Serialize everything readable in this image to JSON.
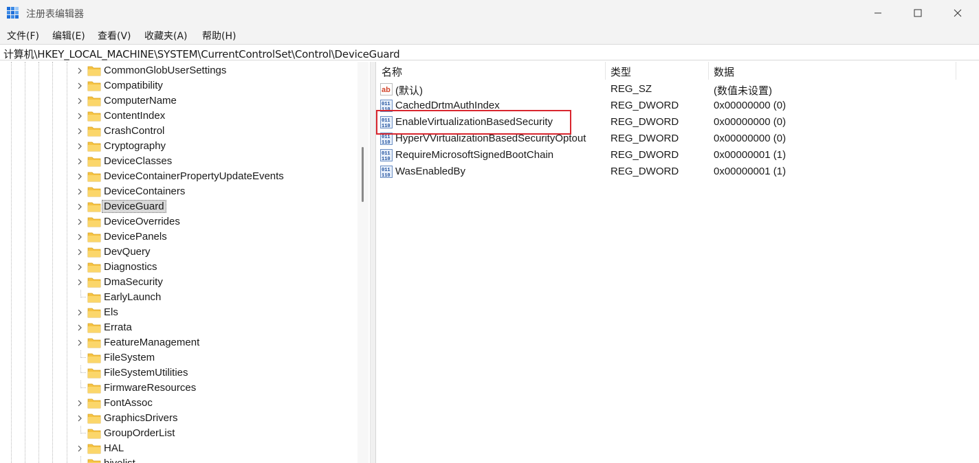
{
  "window": {
    "title": "注册表编辑器"
  },
  "menu": [
    "文件(F)",
    "编辑(E)",
    "查看(V)",
    "收藏夹(A)",
    "帮助(H)"
  ],
  "address": "计算机\\HKEY_LOCAL_MACHINE\\SYSTEM\\CurrentControlSet\\Control\\DeviceGuard",
  "tree": {
    "items": [
      {
        "label": "CommonGlobUserSettings",
        "expandable": true
      },
      {
        "label": "Compatibility",
        "expandable": true
      },
      {
        "label": "ComputerName",
        "expandable": true
      },
      {
        "label": "ContentIndex",
        "expandable": true
      },
      {
        "label": "CrashControl",
        "expandable": true
      },
      {
        "label": "Cryptography",
        "expandable": true
      },
      {
        "label": "DeviceClasses",
        "expandable": true
      },
      {
        "label": "DeviceContainerPropertyUpdateEvents",
        "expandable": true
      },
      {
        "label": "DeviceContainers",
        "expandable": true
      },
      {
        "label": "DeviceGuard",
        "expandable": true,
        "selected": true
      },
      {
        "label": "DeviceOverrides",
        "expandable": true
      },
      {
        "label": "DevicePanels",
        "expandable": true
      },
      {
        "label": "DevQuery",
        "expandable": true
      },
      {
        "label": "Diagnostics",
        "expandable": true
      },
      {
        "label": "DmaSecurity",
        "expandable": true
      },
      {
        "label": "EarlyLaunch",
        "expandable": false
      },
      {
        "label": "Els",
        "expandable": true
      },
      {
        "label": "Errata",
        "expandable": true
      },
      {
        "label": "FeatureManagement",
        "expandable": true
      },
      {
        "label": "FileSystem",
        "expandable": false
      },
      {
        "label": "FileSystemUtilities",
        "expandable": false
      },
      {
        "label": "FirmwareResources",
        "expandable": false
      },
      {
        "label": "FontAssoc",
        "expandable": true
      },
      {
        "label": "GraphicsDrivers",
        "expandable": true
      },
      {
        "label": "GroupOrderList",
        "expandable": false
      },
      {
        "label": "HAL",
        "expandable": true
      },
      {
        "label": "hivelist",
        "expandable": false
      }
    ]
  },
  "list": {
    "columns": {
      "name": "名称",
      "type": "类型",
      "data": "数据"
    },
    "rows": [
      {
        "name": "(默认)",
        "type": "REG_SZ",
        "data": "(数值未设置)",
        "icon": "string-value-icon"
      },
      {
        "name": "CachedDrtmAuthIndex",
        "type": "REG_DWORD",
        "data": "0x00000000 (0)",
        "icon": "binary-value-icon"
      },
      {
        "name": "EnableVirtualizationBasedSecurity",
        "type": "REG_DWORD",
        "data": "0x00000000 (0)",
        "icon": "binary-value-icon",
        "highlighted": true
      },
      {
        "name": "HyperVVirtualizationBasedSecurityOptout",
        "type": "REG_DWORD",
        "data": "0x00000000 (0)",
        "icon": "binary-value-icon"
      },
      {
        "name": "RequireMicrosoftSignedBootChain",
        "type": "REG_DWORD",
        "data": "0x00000001 (1)",
        "icon": "binary-value-icon"
      },
      {
        "name": "WasEnabledBy",
        "type": "REG_DWORD",
        "data": "0x00000001 (1)",
        "icon": "binary-value-icon"
      }
    ]
  },
  "colors": {
    "titlebar": "#f3f3f3",
    "folder": "#f6c342",
    "selection": "#d9d9d9",
    "annotation_border": "#d9262e"
  }
}
